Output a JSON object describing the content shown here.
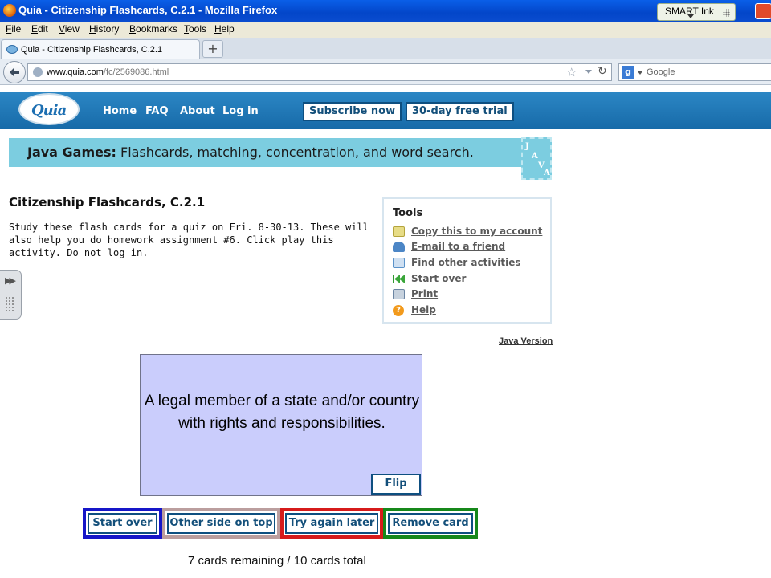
{
  "window": {
    "title": "Quia - Citizenship Flashcards, C.2.1 - Mozilla Firefox",
    "smart_ink_label": "SMART Ink"
  },
  "menu": [
    "File",
    "Edit",
    "View",
    "History",
    "Bookmarks",
    "Tools",
    "Help"
  ],
  "tab": {
    "label": "Quia - Citizenship Flashcards, C.2.1",
    "new_tab_label": "+"
  },
  "address": {
    "host": "www.quia.com",
    "path": "/fc/2569086.html",
    "search_placeholder": "Google"
  },
  "site_nav": {
    "logo_text": "Quia",
    "links": [
      "Home",
      "FAQ",
      "About",
      "Log in"
    ],
    "subscribe_label": "Subscribe now",
    "trial_label": "30-day free trial"
  },
  "banner": {
    "bold": "Java Games:",
    "text": " Flashcards, matching, concentration, and word search.",
    "cup_letters": [
      "J",
      "A",
      "V",
      "A"
    ]
  },
  "activity": {
    "title": "Citizenship Flashcards, C.2.1",
    "description": "Study these flash cards for a quiz on Fri. 8-30-13. These will also help you do homework assignment #6. Click play this activity. Do not log in."
  },
  "tools": {
    "heading": "Tools",
    "items": [
      {
        "label": "Copy this to my account",
        "icon": "copy-icon",
        "color": "#d8c75a"
      },
      {
        "label": "E-mail to a friend",
        "icon": "email-person-icon",
        "color": "#3f7fc1"
      },
      {
        "label": "Find other activities",
        "icon": "find-icon",
        "color": "#5a92c9"
      },
      {
        "label": "Start over",
        "icon": "rewind-icon",
        "color": "#3aa63a"
      },
      {
        "label": "Print",
        "icon": "printer-icon",
        "color": "#6b85a3"
      },
      {
        "label": "Help",
        "icon": "help-icon",
        "color": "#f29a1c"
      }
    ]
  },
  "java_version_label": "Java Version",
  "flashcard": {
    "text": "A legal member of a state and/or country with rights and responsibilities.",
    "flip_label": "Flip",
    "background": "#cacdfc"
  },
  "actions": [
    {
      "label": "Start over",
      "border": "#1616c8"
    },
    {
      "label": "Other side on top",
      "border": "#bb9e9e"
    },
    {
      "label": "Try again later",
      "border": "#d61b1b"
    },
    {
      "label": "Remove card",
      "border": "#16881a"
    }
  ],
  "status": {
    "remaining_text": "7 cards remaining / 10 cards total"
  }
}
